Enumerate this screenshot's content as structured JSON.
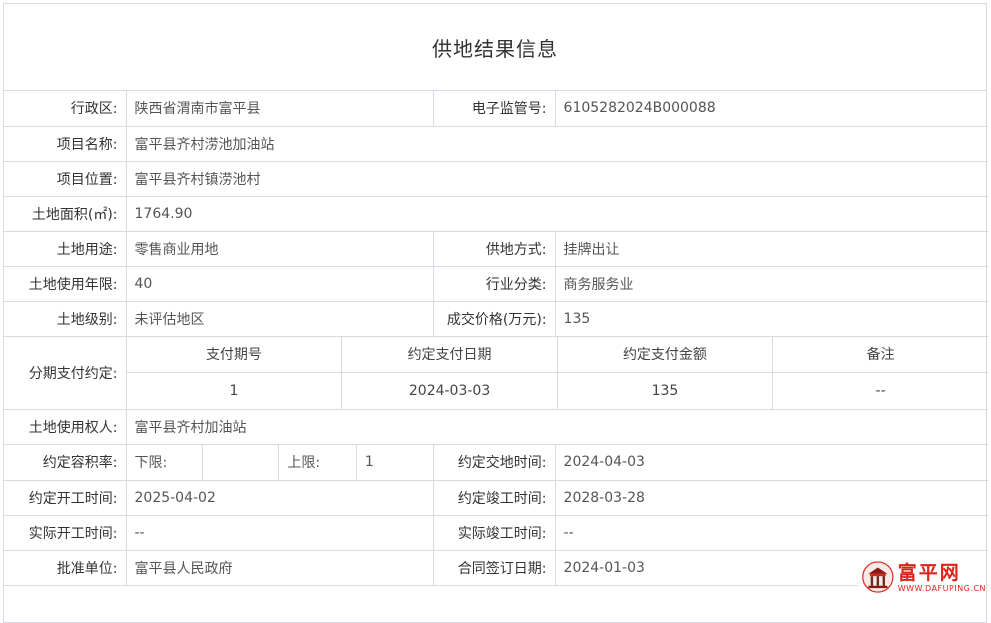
{
  "page": {
    "title": "供地结果信息"
  },
  "labels": {
    "district": "行政区:",
    "supervision_no": "电子监管号:",
    "project_name": "项目名称:",
    "project_location": "项目位置:",
    "land_area": "土地面积(㎡):",
    "land_use": "土地用途:",
    "supply_method": "供地方式:",
    "use_years": "土地使用年限:",
    "industry": "行业分类:",
    "land_grade": "土地级别:",
    "deal_price": "成交价格(万元):",
    "installment": "分期支付约定:",
    "land_user": "土地使用权人:",
    "far": "约定容积率:",
    "far_lower": "下限:",
    "far_upper": "上限:",
    "handover_time": "约定交地时间:",
    "start_time": "约定开工时间:",
    "completion_time": "约定竣工时间:",
    "actual_start": "实际开工时间:",
    "actual_completion": "实际竣工时间:",
    "approval_unit": "批准单位:",
    "contract_date": "合同签订日期:"
  },
  "values": {
    "district": "陕西省渭南市富平县",
    "supervision_no": "6105282024B000088",
    "project_name": "富平县齐村涝池加油站",
    "project_location": "富平县齐村镇涝池村",
    "land_area": "1764.90",
    "land_use": "零售商业用地",
    "supply_method": "挂牌出让",
    "use_years": "40",
    "industry": "商务服务业",
    "land_grade": "未评估地区",
    "deal_price": "135",
    "land_user": "富平县齐村加油站",
    "far_lower": "",
    "far_upper": "1",
    "handover_time": "2024-04-03",
    "start_time": "2025-04-02",
    "completion_time": "2028-03-28",
    "actual_start": "--",
    "actual_completion": "--",
    "approval_unit": "富平县人民政府",
    "contract_date": "2024-01-03"
  },
  "payment_table": {
    "headers": [
      "支付期号",
      "约定支付日期",
      "约定支付金额",
      "备注"
    ],
    "rows": [
      [
        "1",
        "2024-03-03",
        "135",
        "--"
      ]
    ]
  },
  "logo": {
    "text": "富平网",
    "sub": "WWW.DAFUPING.CN",
    "icon": "building-emblem-icon",
    "color": "#d9261c"
  },
  "colors": {
    "border": "#d6dbe3",
    "accent": "#d9261c"
  }
}
